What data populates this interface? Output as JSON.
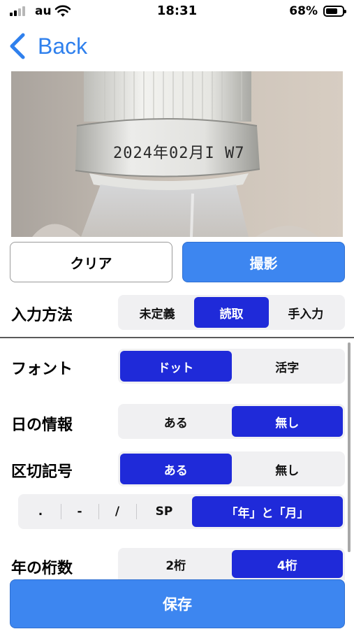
{
  "status_bar": {
    "carrier": "au",
    "time": "18:31",
    "battery": "68%"
  },
  "nav": {
    "back_label": "Back"
  },
  "photo": {
    "printed_code": "2024年02月I W7"
  },
  "buttons": {
    "clear": "クリア",
    "shoot": "撮影",
    "save": "保存"
  },
  "input_method": {
    "label": "入力方法",
    "options": [
      "未定義",
      "読取",
      "手入力"
    ],
    "selected": "読取"
  },
  "font": {
    "label": "フォント",
    "options": [
      "ドット",
      "活字"
    ],
    "selected": "ドット"
  },
  "day_info": {
    "label": "日の情報",
    "options": [
      "ある",
      "無し"
    ],
    "selected": "無し"
  },
  "separator": {
    "label": "区切記号",
    "options": [
      "ある",
      "無し"
    ],
    "selected": "ある"
  },
  "separator_symbols": {
    "options": [
      ".",
      "-",
      "/",
      "SP",
      "「年」と「月」"
    ],
    "selected": "「年」と「月」"
  },
  "year_digits": {
    "label": "年の桁数",
    "options": [
      "2桁",
      "4桁"
    ],
    "selected": "4桁"
  },
  "colors": {
    "accent": "#3d86f0",
    "selected": "#1f2ad9",
    "segment_bg": "#f0f0f2"
  }
}
